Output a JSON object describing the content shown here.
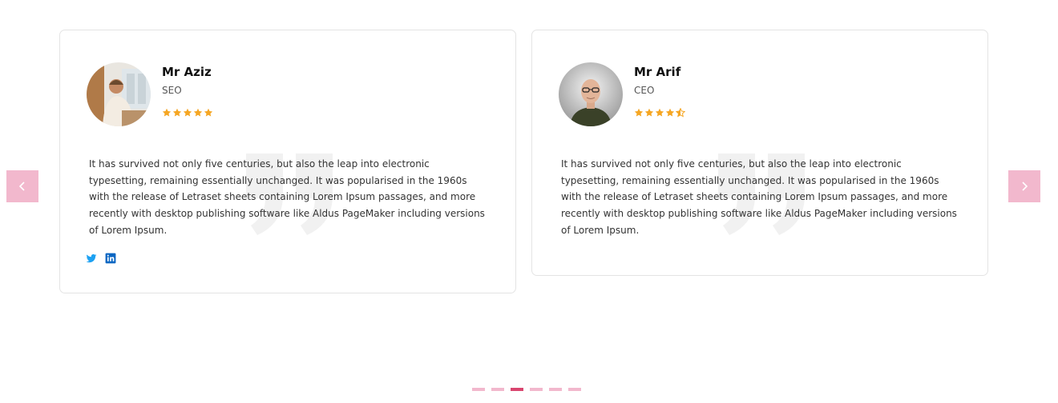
{
  "colors": {
    "accent": "#f2b8cd",
    "active_dot": "#d9456f",
    "star": "#f5a623",
    "twitter": "#1da1f2",
    "linkedin": "#0a66c2"
  },
  "testimonials": [
    {
      "name": "Mr Aziz",
      "role": "SEO",
      "rating": 5,
      "text": "It has survived not only five centuries, but also the leap into electronic typesetting, remaining essentially unchanged. It was popularised in the 1960s with the release of Letraset sheets containing Lorem Ipsum passages, and more recently with desktop publishing software like Aldus PageMaker including versions of Lorem Ipsum.",
      "socials": [
        "twitter-icon",
        "linkedin-icon"
      ]
    },
    {
      "name": "Mr Arif",
      "role": "CEO",
      "rating": 4.5,
      "text": "It has survived not only five centuries, but also the leap into electronic typesetting, remaining essentially unchanged. It was popularised in the 1960s with the release of Letraset sheets containing Lorem Ipsum passages, and more recently with desktop publishing software like Aldus PageMaker including versions of Lorem Ipsum.",
      "socials": []
    }
  ],
  "carousel": {
    "prev_icon": "chevron-left-icon",
    "next_icon": "chevron-right-icon",
    "dot_count": 6,
    "active_dot": 3
  }
}
